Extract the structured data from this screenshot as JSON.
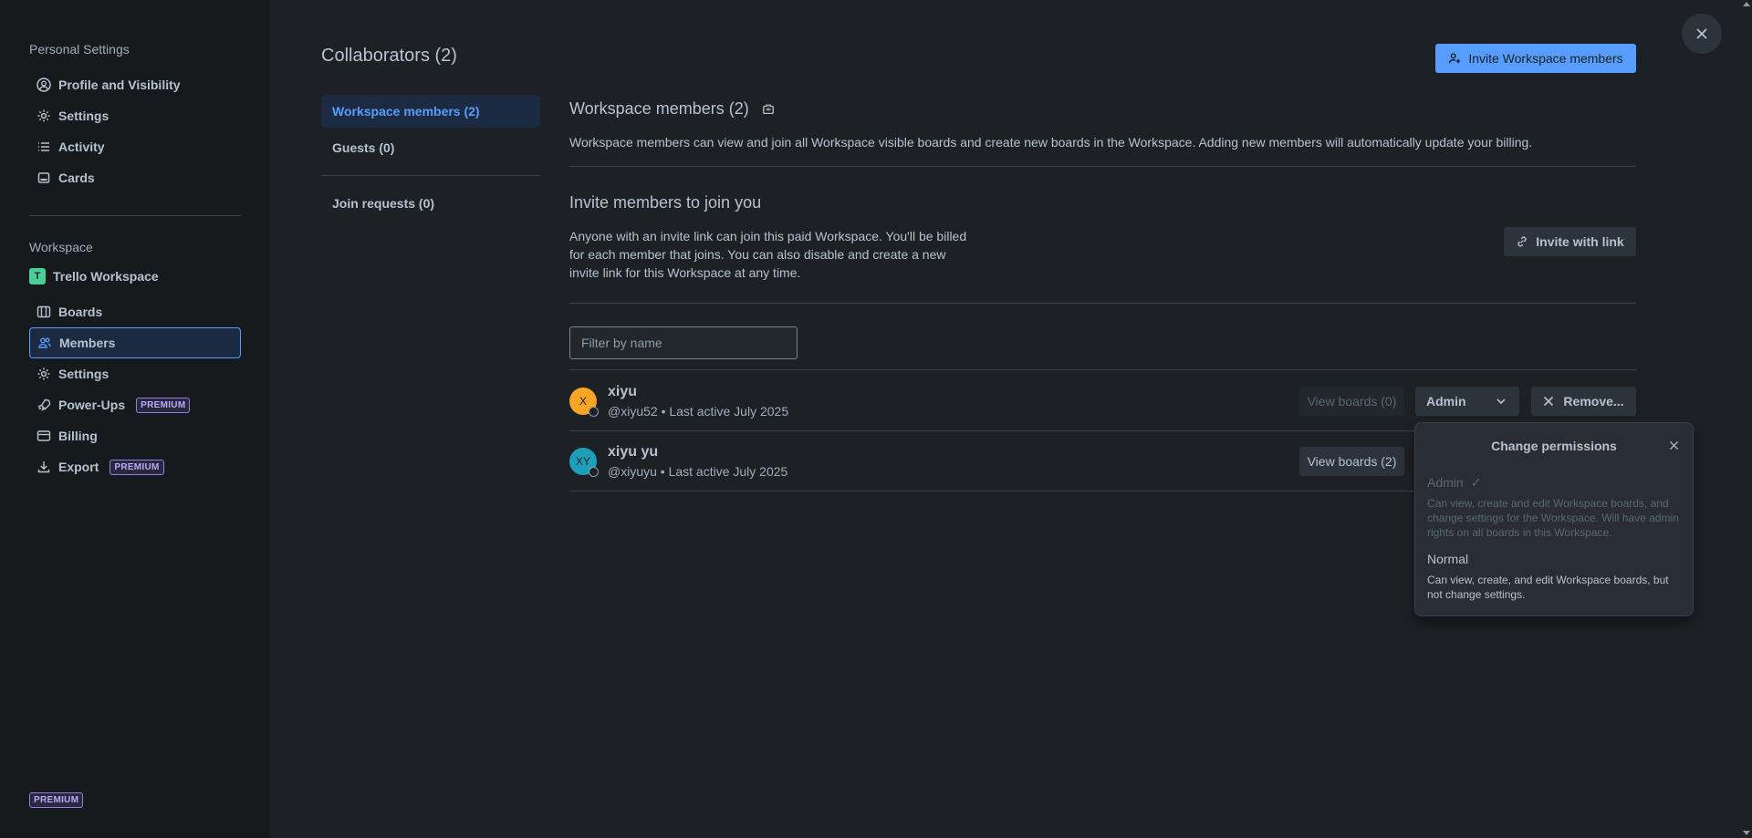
{
  "sidebar": {
    "personal_heading": "Personal Settings",
    "personal_items": [
      {
        "label": "Profile and Visibility",
        "icon": "person-circle-icon"
      },
      {
        "label": "Settings",
        "icon": "gear-icon"
      },
      {
        "label": "Activity",
        "icon": "list-icon"
      },
      {
        "label": "Cards",
        "icon": "card-icon"
      }
    ],
    "workspace_heading": "Workspace",
    "workspace_name": "Trello Workspace",
    "workspace_badge": "T",
    "workspace_items": [
      {
        "label": "Boards",
        "icon": "boards-icon"
      },
      {
        "label": "Members",
        "icon": "people-icon"
      },
      {
        "label": "Settings",
        "icon": "gear-icon"
      },
      {
        "label": "Power-Ups",
        "icon": "rocket-icon",
        "badge": "PREMIUM"
      },
      {
        "label": "Billing",
        "icon": "credit-card-icon"
      },
      {
        "label": "Export",
        "icon": "download-icon",
        "badge": "PREMIUM"
      }
    ],
    "footer_badge": "PREMIUM"
  },
  "main": {
    "title": "Collaborators (2)",
    "invite_button": "Invite Workspace members",
    "tabs": [
      {
        "label": "Workspace members (2)"
      },
      {
        "label": "Guests (0)"
      },
      {
        "label": "Join requests (0)"
      }
    ],
    "section_title": "Workspace members (2)",
    "section_desc": "Workspace members can view and join all Workspace visible boards and create new boards in the Workspace. Adding new members will automatically update your billing.",
    "invite_title": "Invite members to join you",
    "invite_desc_lines": [
      "Anyone with an invite link can join this paid Workspace. You'll be billed",
      "for each member that joins. You can also disable and create a new",
      "invite link for this Workspace at any time."
    ],
    "invite_link_button": "Invite with link",
    "filter_placeholder": "Filter by name",
    "members": [
      {
        "initials": "X",
        "name": "xiyu",
        "sub": "@xiyu52 • Last active July 2025",
        "view_boards": "View boards (0)",
        "role": "Admin",
        "remove": "Remove...",
        "avatar_color": "#f8a427"
      },
      {
        "initials": "XY",
        "name": "xiyu yu",
        "sub": "@xiyuyu • Last active July 2025",
        "view_boards": "View boards (2)",
        "avatar_color": "#1d9fba"
      }
    ]
  },
  "popover": {
    "title": "Change permissions",
    "options": [
      {
        "title": "Admin",
        "check": "✓",
        "desc_lines": [
          "Can view, create and edit Workspace boards, and",
          "change settings for the Workspace. Will have admin",
          "rights on all boards in this Workspace."
        ]
      },
      {
        "title": "Normal",
        "desc_lines": [
          "Can view, create, and edit Workspace boards, but",
          "not change settings."
        ]
      }
    ]
  }
}
